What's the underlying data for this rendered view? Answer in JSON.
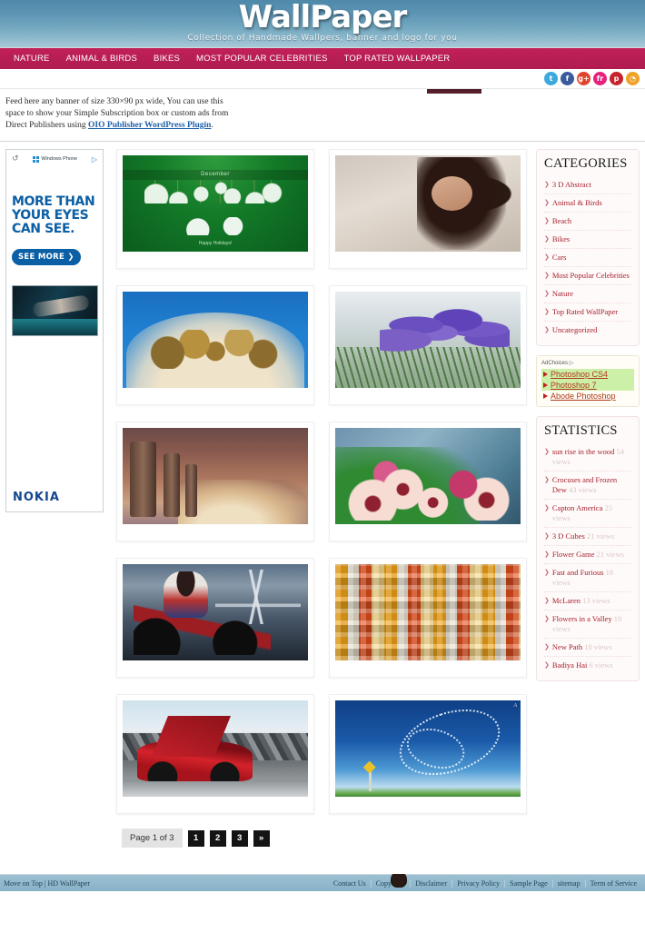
{
  "header": {
    "title": "WallPaper",
    "tagline": "Collection of Handmade Wallpers, banner and logo for you"
  },
  "nav": {
    "items": [
      {
        "label": "NATURE"
      },
      {
        "label": "ANIMAL & BIRDS"
      },
      {
        "label": "BIKES"
      },
      {
        "label": "MOST POPULAR CELEBRITIES"
      },
      {
        "label": "TOP RATED WALLPAPER"
      }
    ]
  },
  "social": {
    "items": [
      {
        "name": "twitter-icon",
        "glyph": "t"
      },
      {
        "name": "facebook-icon",
        "glyph": "f"
      },
      {
        "name": "googleplus-icon",
        "glyph": "g+"
      },
      {
        "name": "flickr-icon",
        "glyph": "fr"
      },
      {
        "name": "pinterest-icon",
        "glyph": "p"
      },
      {
        "name": "rss-icon",
        "glyph": "◔"
      }
    ]
  },
  "feed_banner": {
    "line1": "Feed here any banner of size 330×90 px wide, You can use this",
    "line2": "space to show your Simple Subscription box or custom ads from",
    "line3_prefix": "Direct Publishers using ",
    "link": "OIO Publisher WordPress Plugin",
    "line3_suffix": "."
  },
  "left_ad": {
    "refresh_glyph": "↺",
    "brand_top": "Windows Phone",
    "adchoices_glyph": "▷",
    "headline": "MORE THAN YOUR EYES CAN SEE.",
    "cta": "SEE MORE ❯",
    "brand_bottom": "NOKIA"
  },
  "gallery": {
    "items": [
      {
        "name": "thumb-december-holidays",
        "art": "t-xmas",
        "caption": "December",
        "subcaption": "Happy Holidays!"
      },
      {
        "name": "thumb-celebrity-beach",
        "art": "t-celeb"
      },
      {
        "name": "thumb-dandelion-dew",
        "art": "t-dandelion"
      },
      {
        "name": "thumb-crocuses-frozen-dew",
        "art": "t-crocus"
      },
      {
        "name": "thumb-sun-rise-in-the-wood",
        "art": "t-forest"
      },
      {
        "name": "thumb-flowers-in-a-valley",
        "art": "t-petunia"
      },
      {
        "name": "thumb-bike-and-girl",
        "art": "t-bike"
      },
      {
        "name": "thumb-3d-cubes",
        "art": "t-cubes"
      },
      {
        "name": "thumb-mclaren",
        "art": "t-mclaren"
      },
      {
        "name": "thumb-birds-in-sky",
        "art": "t-birds",
        "signature": "A"
      }
    ]
  },
  "pagination": {
    "page_label": "Page 1 of 3",
    "pages": [
      {
        "label": "1"
      },
      {
        "label": "2"
      },
      {
        "label": "3"
      },
      {
        "label": "»"
      }
    ]
  },
  "sidebar": {
    "categories": {
      "title": "CATEGORIES",
      "items": [
        {
          "label": "3 D Abstract"
        },
        {
          "label": "Animal & Birds"
        },
        {
          "label": "Beach"
        },
        {
          "label": "Bikes"
        },
        {
          "label": "Cars"
        },
        {
          "label": "Most Popular Celebrities"
        },
        {
          "label": "Nature"
        },
        {
          "label": "Top Rated WallPaper"
        },
        {
          "label": "Uncategorized"
        }
      ]
    },
    "ad": {
      "adchoices": "AdChoices",
      "links": [
        {
          "label": "Photoshop CS4",
          "highlight": true
        },
        {
          "label": "Photoshop 7",
          "highlight": true
        },
        {
          "label": "Abode Photoshop",
          "highlight": false
        }
      ]
    },
    "statistics": {
      "title": "STATISTICS",
      "items": [
        {
          "label": "sun rise in the wood",
          "views": "54 views"
        },
        {
          "label": "Crocuses and Frozen Dew",
          "views": "43 views"
        },
        {
          "label": "Capton America",
          "views": "25 views"
        },
        {
          "label": "3 D Cubes",
          "views": "21 views"
        },
        {
          "label": "Flower Game",
          "views": "21 views"
        },
        {
          "label": "Fast and Furious",
          "views": "18 views"
        },
        {
          "label": "McLaren",
          "views": "13 views"
        },
        {
          "label": "Flowers in a Valley",
          "views": "10 views"
        },
        {
          "label": "New Path",
          "views": "10 views"
        },
        {
          "label": "Badiya Hai",
          "views": "6 views"
        }
      ]
    }
  },
  "footer": {
    "left": "Move on Top | HD WallPaper",
    "links": [
      {
        "label": "Contact Us"
      },
      {
        "label": "Copyright"
      },
      {
        "label": "Disclaimer"
      },
      {
        "label": "Privacy Policy"
      },
      {
        "label": "Sample Page"
      },
      {
        "label": "sitemap"
      },
      {
        "label": "Term of Service"
      }
    ]
  },
  "colors": {
    "nav_bg": "#b81e52",
    "header_blue": "#5d95b4",
    "link_red": "#a5202c",
    "footer_bg": "#93b9cd"
  }
}
